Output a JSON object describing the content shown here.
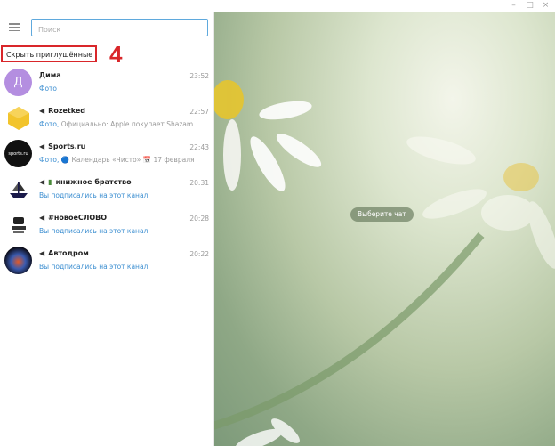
{
  "window": {
    "controls": [
      "–",
      "□",
      "×"
    ]
  },
  "sidebar": {
    "search_placeholder": "Поиск",
    "hide_muted_label": "Скрыть приглушённые",
    "annotation_number": "4",
    "chats": [
      {
        "name": "Дима",
        "time": "23:52",
        "preview": "Фото",
        "preview_prefix": "",
        "channel": false,
        "avatar_letter": "Д",
        "avatar_color": "#b48ee0"
      },
      {
        "name": "Rozetked",
        "time": "22:57",
        "preview_prefix": "Фото, ",
        "preview": "Официально: Apple покупает Shazam",
        "channel": true,
        "avatar_color": "#f2c42c"
      },
      {
        "name": "Sports.ru",
        "time": "22:43",
        "preview_prefix": "Фото, ",
        "preview": "🔵 Календарь «Чисто» 📅 17 февраля",
        "channel": true,
        "avatar_color": "#111111"
      },
      {
        "name": "книжное братство",
        "time": "20:31",
        "preview_prefix": "",
        "preview": "Вы подписались на этот канал",
        "channel": true,
        "avatar_color": "#ffffff"
      },
      {
        "name": "#новоеСЛОВО",
        "time": "20:28",
        "preview_prefix": "",
        "preview": "Вы подписались на этот канал",
        "channel": true,
        "avatar_color": "#ffffff"
      },
      {
        "name": "Автодром",
        "time": "20:22",
        "preview_prefix": "",
        "preview": "Вы подписались на этот канал",
        "channel": true,
        "avatar_color": "#1a1a2a"
      }
    ]
  },
  "main": {
    "placeholder": "Выберите чат"
  },
  "colors": {
    "accent": "#3d8fd1",
    "annotation_red": "#d9262a"
  }
}
